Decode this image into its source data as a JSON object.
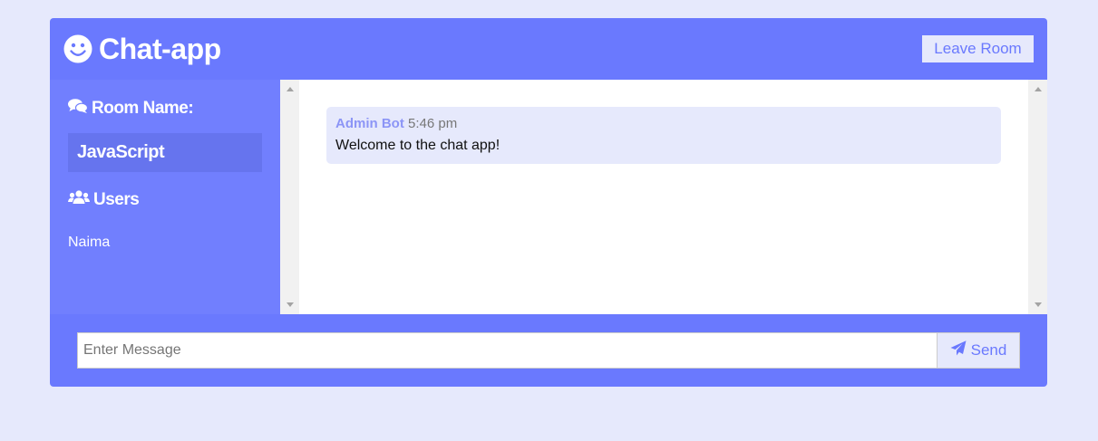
{
  "colors": {
    "page_bg": "#e6e9fc",
    "primary": "#6a79fe",
    "sidebar": "#717ffe",
    "room_highlight": "#6674ee",
    "message_bg": "#e6e9fc",
    "author": "#8c95f6"
  },
  "header": {
    "icon": "smile-icon",
    "title": "Chat-app",
    "leave_label": "Leave Room"
  },
  "sidebar": {
    "room_icon": "comments-icon",
    "room_heading": "Room Name:",
    "room_name": "JavaScript",
    "users_icon": "users-icon",
    "users_heading": "Users",
    "users": [
      "Naima"
    ]
  },
  "messages": [
    {
      "author": "Admin Bot",
      "time": "5:46 pm",
      "text": "Welcome to the chat app!"
    }
  ],
  "form": {
    "placeholder": "Enter Message",
    "value": "",
    "send_icon": "paper-plane-icon",
    "send_label": "Send"
  }
}
